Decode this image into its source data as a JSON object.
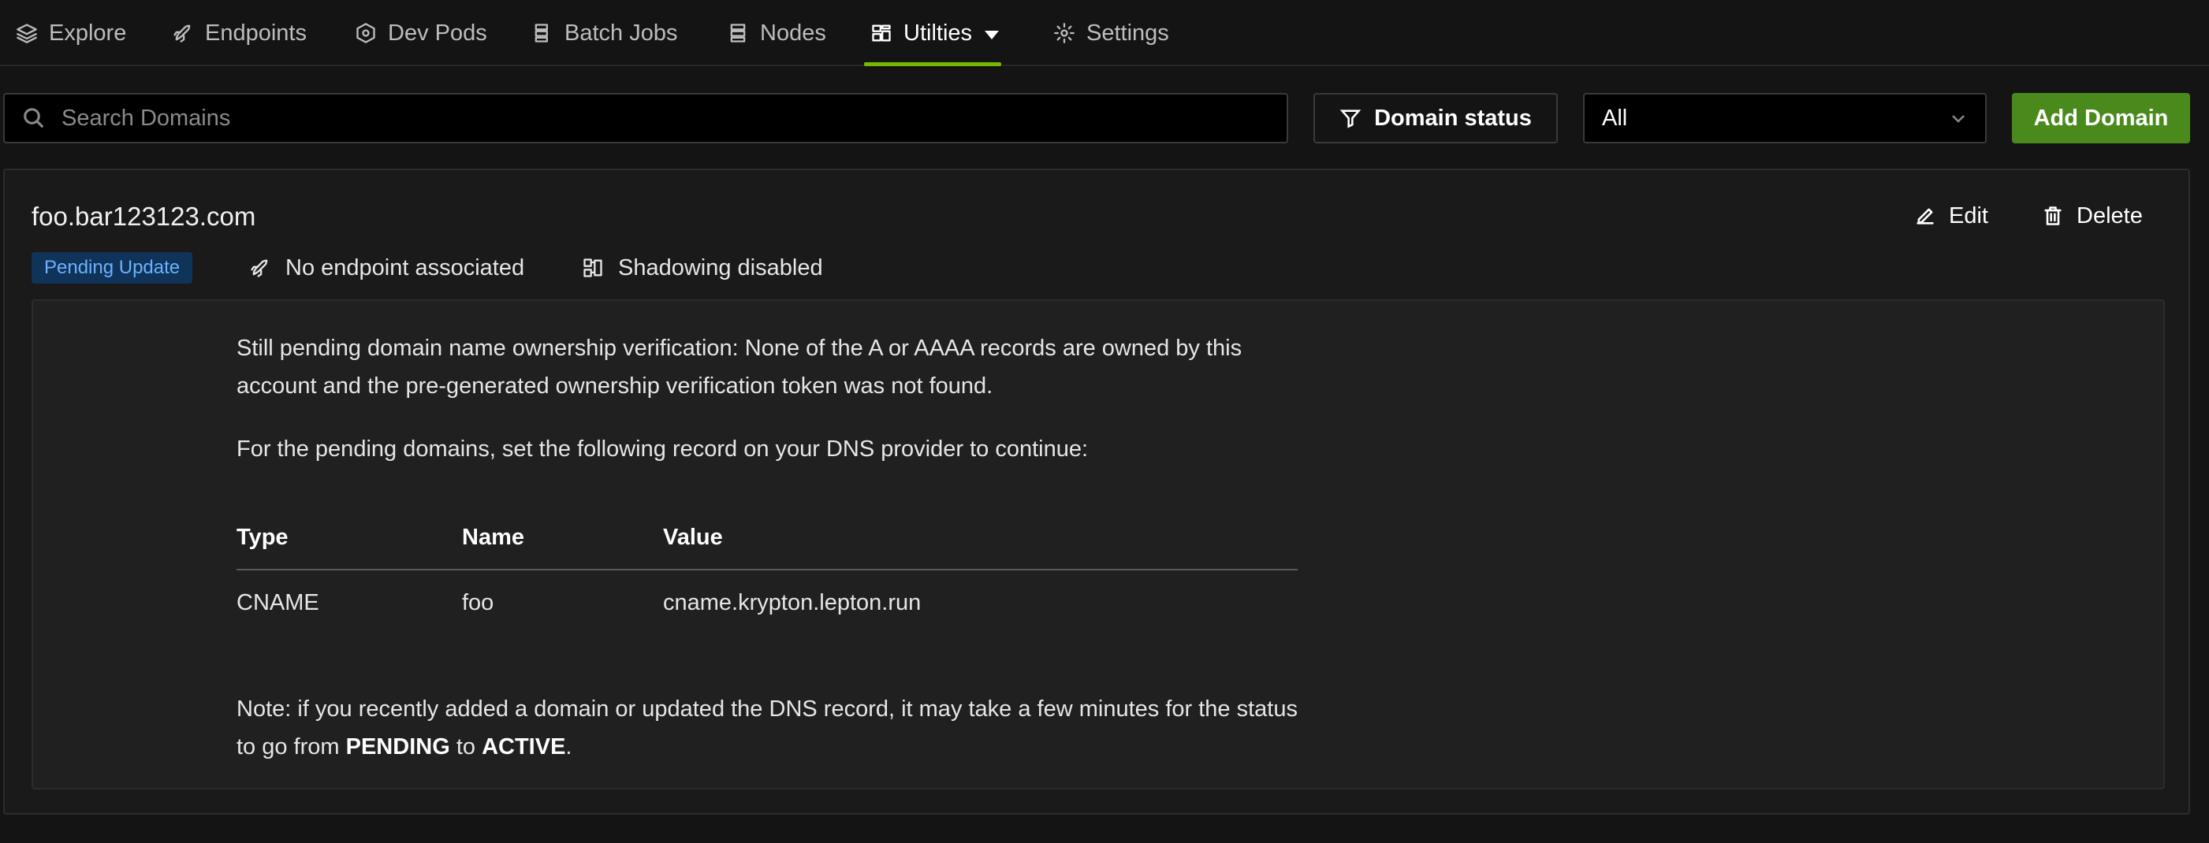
{
  "nav": {
    "items": [
      {
        "label": "Explore",
        "icon": "layers-icon"
      },
      {
        "label": "Endpoints",
        "icon": "rocket-icon"
      },
      {
        "label": "Dev Pods",
        "icon": "hexagon-icon"
      },
      {
        "label": "Batch Jobs",
        "icon": "list-stack-icon"
      },
      {
        "label": "Nodes",
        "icon": "server-icon"
      },
      {
        "label": "Utilties",
        "icon": "grid-icon"
      },
      {
        "label": "Settings",
        "icon": "gear-icon"
      }
    ],
    "active_index": 5,
    "accent_color": "#76b900"
  },
  "toolbar": {
    "search_placeholder": "Search Domains",
    "status_filter_label": "Domain status",
    "status_select_value": "All",
    "add_button_label": "Add Domain",
    "add_button_color": "#4a8a1c"
  },
  "domain": {
    "name": "foo.bar123123.com",
    "edit_label": "Edit",
    "delete_label": "Delete",
    "status_badge": "Pending Update",
    "endpoint_text": "No endpoint associated",
    "shadowing_text": "Shadowing disabled",
    "message_1": "Still pending domain name ownership verification: None of the A or AAAA records are owned by this account and the pre-generated ownership verification token was not found.",
    "message_2": "For the pending domains, set the following record on your DNS provider to continue:",
    "record_table": {
      "headers": [
        "Type",
        "Name",
        "Value"
      ],
      "rows": [
        [
          "CNAME",
          "foo",
          "cname.krypton.lepton.run"
        ]
      ]
    },
    "note_prefix": "Note: if you recently added a domain or updated the DNS record, it may take a few minutes for the status to go from ",
    "note_pending": "PENDING",
    "note_to": " to ",
    "note_active": "ACTIVE",
    "note_suffix": "."
  }
}
